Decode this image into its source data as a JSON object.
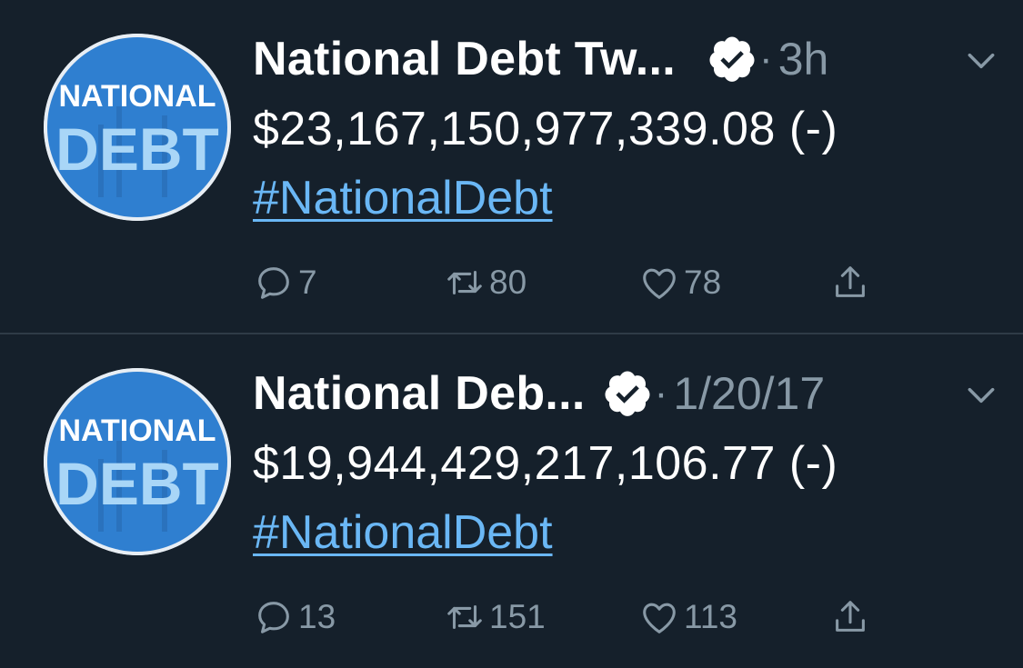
{
  "tweets": [
    {
      "avatar_line1": "NATIONAL",
      "avatar_line2": "DEBT",
      "name": "National Debt Tw...",
      "separator": "·",
      "time": "3h",
      "amount": "$23,167,150,977,339.08 (-)",
      "hashtag": "#NationalDebt",
      "replies": "7",
      "retweets": "80",
      "likes": "78"
    },
    {
      "avatar_line1": "NATIONAL",
      "avatar_line2": "DEBT",
      "name": "National Deb...",
      "separator": "·",
      "time": "1/20/17",
      "amount": "$19,944,429,217,106.77 (-)",
      "hashtag": "#NationalDebt",
      "replies": "13",
      "retweets": "151",
      "likes": "113"
    }
  ],
  "icons": {
    "verified": "verified-badge-icon",
    "caret": "chevron-down-icon",
    "reply": "reply-icon",
    "retweet": "retweet-icon",
    "like": "heart-icon",
    "share": "share-icon"
  },
  "colors": {
    "background": "#15202b",
    "secondary_text": "#8899a6",
    "link": "#6ab7f5",
    "avatar_blue": "#2f7fd0"
  }
}
